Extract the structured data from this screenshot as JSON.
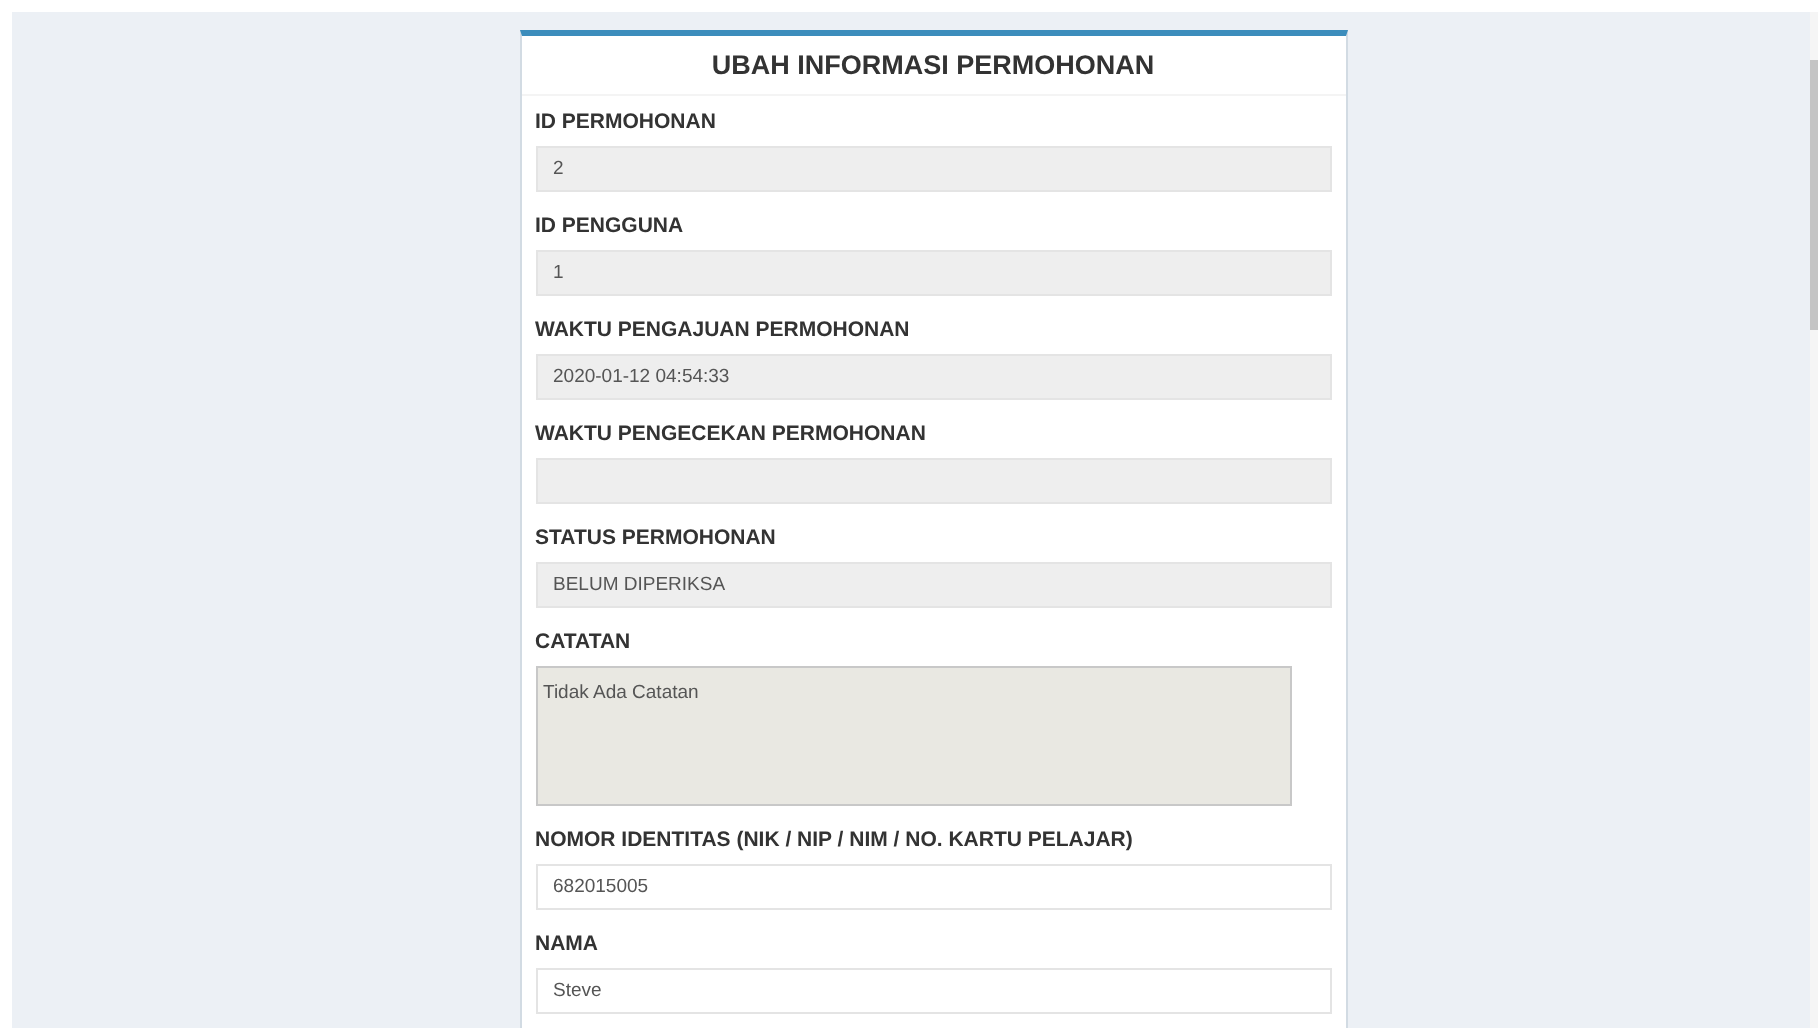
{
  "form": {
    "title": "UBAH INFORMASI PERMOHONAN",
    "fields": [
      {
        "label": "ID PERMOHONAN",
        "kind": "input",
        "readonly": true,
        "value": "2"
      },
      {
        "label": "ID PENGGUNA",
        "kind": "input",
        "readonly": true,
        "value": "1"
      },
      {
        "label": "WAKTU PENGAJUAN PERMOHONAN",
        "kind": "input",
        "readonly": true,
        "value": "2020-01-12 04:54:33"
      },
      {
        "label": "WAKTU PENGECEKAN PERMOHONAN",
        "kind": "input",
        "readonly": true
      },
      {
        "label": "STATUS PERMOHONAN",
        "kind": "input",
        "readonly": true,
        "value": "BELUM DIPERIKSA"
      },
      {
        "label": "CATATAN",
        "kind": "textarea",
        "readonly": true,
        "value": "Tidak Ada Catatan"
      },
      {
        "label": "NOMOR IDENTITAS (NIK / NIP / NIM / NO. KARTU PELAJAR)",
        "kind": "input",
        "readonly": false,
        "value": "682015005"
      },
      {
        "label": "NAMA",
        "kind": "input",
        "readonly": false,
        "value": "Steve"
      }
    ]
  }
}
